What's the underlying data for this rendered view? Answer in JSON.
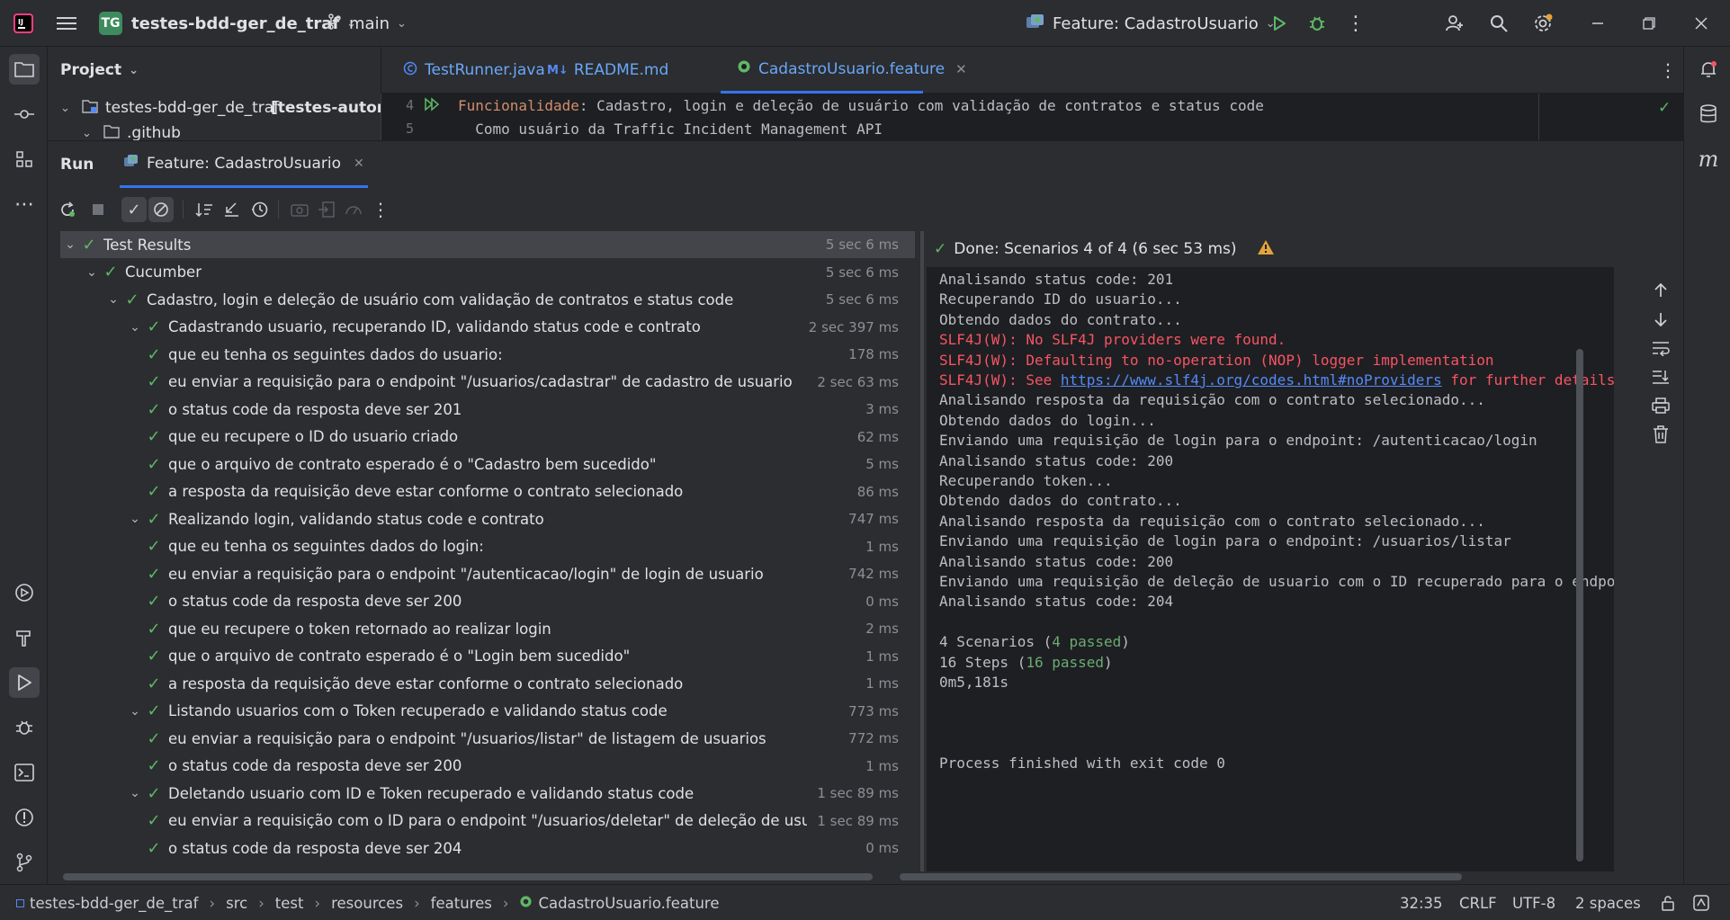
{
  "titlebar": {
    "project_badge": "TG",
    "project_name": "testes-bdd-ger_de_traf",
    "branch": "main",
    "run_config": "Feature: CadastroUsuario"
  },
  "project_panel": {
    "title": "Project",
    "tree": [
      {
        "label": "testes-bdd-ger_de_traf",
        "module": "[testes-autom"
      },
      {
        "label": ".github"
      }
    ]
  },
  "editor": {
    "tabs": [
      {
        "label": "TestRunner.java"
      },
      {
        "label": "README.md"
      },
      {
        "label": "CadastroUsuario.feature",
        "active": true
      }
    ],
    "lines": [
      {
        "num": "4",
        "keyword": "Funcionalidade",
        "text": ": Cadastro, login e deleção de usuário com validação de contratos e status code"
      },
      {
        "num": "5",
        "text": "  Como usuário da Traffic Incident Management API"
      }
    ]
  },
  "run": {
    "label": "Run",
    "tab": "Feature: CadastroUsuario",
    "tree": [
      {
        "label": "Test Results",
        "dur": "5 sec 6 ms",
        "level": 0,
        "chev": true,
        "sel": true
      },
      {
        "label": "Cucumber",
        "dur": "5 sec 6 ms",
        "level": 1,
        "chev": true
      },
      {
        "label": "Cadastro, login e deleção de usuário com validação de contratos e status code",
        "dur": "5 sec 6 ms",
        "level": 2,
        "chev": true
      },
      {
        "label": "Cadastrando usuario, recuperando ID, validando status code e contrato",
        "dur": "2 sec 397 ms",
        "level": 3,
        "chev": true
      },
      {
        "label": "que eu tenha os seguintes dados do usuario:",
        "dur": "178 ms",
        "level": 4
      },
      {
        "label": "eu enviar a requisição para o endpoint \"/usuarios/cadastrar\" de cadastro de usuario",
        "dur": "2 sec 63 ms",
        "level": 4
      },
      {
        "label": "o status code da resposta deve ser 201",
        "dur": "3 ms",
        "level": 4
      },
      {
        "label": "que eu recupere o ID do usuario criado",
        "dur": "62 ms",
        "level": 4
      },
      {
        "label": "que o arquivo de contrato esperado é o \"Cadastro bem sucedido\"",
        "dur": "5 ms",
        "level": 4
      },
      {
        "label": "a resposta da requisição deve estar conforme o contrato selecionado",
        "dur": "86 ms",
        "level": 4
      },
      {
        "label": "Realizando login, validando status code e contrato",
        "dur": "747 ms",
        "level": 3,
        "chev": true
      },
      {
        "label": "que eu tenha os seguintes dados do login:",
        "dur": "1 ms",
        "level": 4
      },
      {
        "label": "eu enviar a requisição para o endpoint \"/autenticacao/login\" de login de usuario",
        "dur": "742 ms",
        "level": 4
      },
      {
        "label": "o status code da resposta deve ser 200",
        "dur": "0 ms",
        "level": 4
      },
      {
        "label": "que eu recupere o token retornado ao realizar login",
        "dur": "2 ms",
        "level": 4
      },
      {
        "label": "que o arquivo de contrato esperado é o \"Login bem sucedido\"",
        "dur": "1 ms",
        "level": 4
      },
      {
        "label": "a resposta da requisição deve estar conforme o contrato selecionado",
        "dur": "1 ms",
        "level": 4
      },
      {
        "label": "Listando usuarios com o Token recuperado e validando status code",
        "dur": "773 ms",
        "level": 3,
        "chev": true
      },
      {
        "label": "eu enviar a requisição para o endpoint \"/usuarios/listar\" de listagem de usuarios",
        "dur": "772 ms",
        "level": 4
      },
      {
        "label": "o status code da resposta deve ser 200",
        "dur": "1 ms",
        "level": 4
      },
      {
        "label": "Deletando usuario com ID e Token recuperado e validando status code",
        "dur": "1 sec 89 ms",
        "level": 3,
        "chev": true
      },
      {
        "label": "eu enviar a requisição com o ID para o endpoint \"/usuarios/deletar\" de deleção de usuario",
        "dur": "1 sec 89 ms",
        "level": 4
      },
      {
        "label": "o status code da resposta deve ser 204",
        "dur": "0 ms",
        "level": 4
      }
    ],
    "console_status": "Done: Scenarios 4 of 4  (6 sec 53 ms)",
    "console": [
      {
        "segs": [
          {
            "t": "Analisando status code: 201"
          }
        ]
      },
      {
        "segs": [
          {
            "t": "Recuperando ID do usuario..."
          }
        ]
      },
      {
        "segs": [
          {
            "t": "Obtendo dados do contrato..."
          }
        ]
      },
      {
        "segs": [
          {
            "t": "SLF4J(W): No SLF4J providers were found.",
            "c": "err"
          }
        ]
      },
      {
        "segs": [
          {
            "t": "SLF4J(W): Defaulting to no-operation (NOP) logger implementation",
            "c": "err"
          }
        ]
      },
      {
        "segs": [
          {
            "t": "SLF4J(W): See ",
            "c": "err"
          },
          {
            "t": "https://www.slf4j.org/codes.html#noProviders",
            "c": "lnk"
          },
          {
            "t": " for further details.",
            "c": "err"
          }
        ]
      },
      {
        "segs": [
          {
            "t": "Analisando resposta da requisição com o contrato selecionado..."
          }
        ]
      },
      {
        "segs": [
          {
            "t": "Obtendo dados do login..."
          }
        ]
      },
      {
        "segs": [
          {
            "t": "Enviando uma requisição de login para o endpoint: /autenticacao/login"
          }
        ]
      },
      {
        "segs": [
          {
            "t": "Analisando status code: 200"
          }
        ]
      },
      {
        "segs": [
          {
            "t": "Recuperando token..."
          }
        ]
      },
      {
        "segs": [
          {
            "t": "Obtendo dados do contrato..."
          }
        ]
      },
      {
        "segs": [
          {
            "t": "Analisando resposta da requisição com o contrato selecionado..."
          }
        ]
      },
      {
        "segs": [
          {
            "t": "Enviando uma requisição de login para o endpoint: /usuarios/listar"
          }
        ]
      },
      {
        "segs": [
          {
            "t": "Analisando status code: 200"
          }
        ]
      },
      {
        "segs": [
          {
            "t": "Enviando uma requisição de deleção de usuario com o ID recuperado para o endpoint: /usuarios/deletar"
          }
        ]
      },
      {
        "segs": [
          {
            "t": "Analisando status code: 204"
          }
        ]
      },
      {
        "segs": []
      },
      {
        "segs": [
          {
            "t": "4 Scenarios ("
          },
          {
            "t": "4 passed",
            "c": "ok"
          },
          {
            "t": ")"
          }
        ]
      },
      {
        "segs": [
          {
            "t": "16 Steps ("
          },
          {
            "t": "16 passed",
            "c": "ok"
          },
          {
            "t": ")"
          }
        ]
      },
      {
        "segs": [
          {
            "t": "0m5,181s"
          }
        ]
      },
      {
        "segs": []
      },
      {
        "segs": []
      },
      {
        "segs": []
      },
      {
        "segs": [
          {
            "t": "Process finished with exit code 0"
          }
        ]
      }
    ]
  },
  "statusbar": {
    "breadcrumb": [
      "testes-bdd-ger_de_traf",
      "src",
      "test",
      "resources",
      "features",
      "CadastroUsuario.feature"
    ],
    "position": "32:35",
    "line_sep": "CRLF",
    "encoding": "UTF-8",
    "indent": "2 spaces"
  },
  "colors": {
    "pass": "#5fb865",
    "accent": "#3574f0",
    "error": "#f75464",
    "link": "#548af7"
  }
}
